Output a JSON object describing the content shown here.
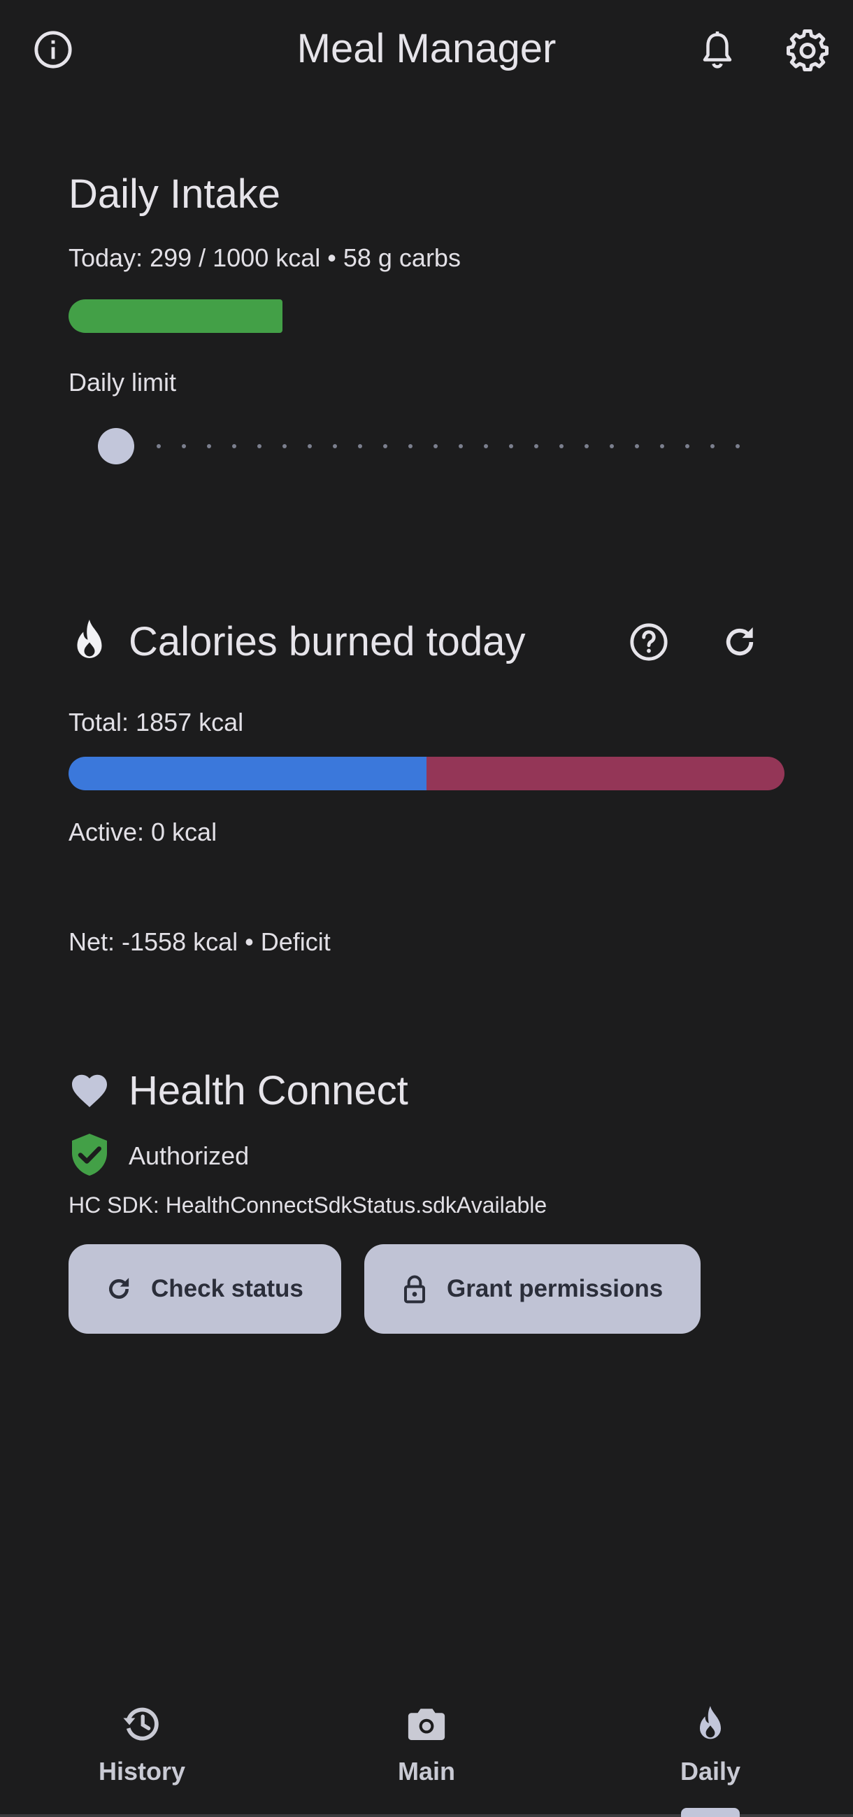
{
  "app_bar": {
    "title": "Meal Manager",
    "icons": [
      "info-icon",
      "bell-icon",
      "gear-icon"
    ]
  },
  "daily_intake": {
    "title": "Daily Intake",
    "summary": "Today: 299 / 1000 kcal • 58 g carbs",
    "progress_fraction": 0.299,
    "progress_color": "#43a047",
    "limit_label": "Daily limit",
    "slider_position": 0
  },
  "calories_burned": {
    "title": "Calories burned today",
    "total_label": "Total: 1857 kcal",
    "bar_split_fraction": 0.5,
    "bar_colors": [
      "#3b78db",
      "#943657"
    ],
    "active_label": "Active: 0 kcal",
    "net_label": "Net: -1558 kcal • Deficit"
  },
  "health_connect": {
    "title": "Health Connect",
    "status": "Authorized",
    "status_color": "#43a047",
    "sdk_label": "HC SDK: HealthConnectSdkStatus.sdkAvailable",
    "check_status_label": "Check status",
    "grant_permissions_label": "Grant permissions"
  },
  "bottom_nav": {
    "items": [
      {
        "label": "History",
        "icon": "history-icon"
      },
      {
        "label": "Main",
        "icon": "camera-icon"
      },
      {
        "label": "Daily",
        "icon": "flame-icon"
      }
    ],
    "selected": "Daily"
  }
}
